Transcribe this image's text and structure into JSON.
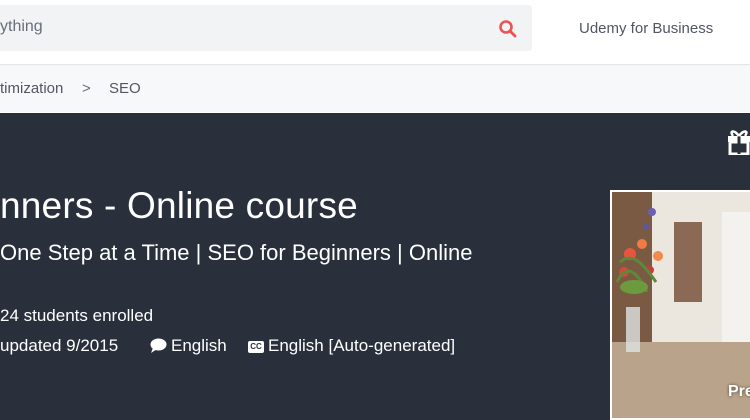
{
  "header": {
    "search_value": "ything",
    "business_link": "Udemy for Business"
  },
  "breadcrumb": {
    "items": [
      "timization",
      "SEO"
    ],
    "separator": ">"
  },
  "course": {
    "title": "nners - Online course",
    "subtitle": "One Step at a Time | SEO for Beginners | Online",
    "students": "24 students enrolled",
    "updated": "updated 9/2015",
    "language": "English",
    "captions": "English [Auto-generated]",
    "cc_badge": "CC",
    "preview_label": "Pre"
  },
  "colors": {
    "hero_bg": "#29303b",
    "search_icon": "#ec5252",
    "breadcrumb_bg": "#f7f8fa"
  },
  "icons": [
    "search-icon",
    "gift-icon",
    "comment-icon",
    "cc-icon"
  ]
}
